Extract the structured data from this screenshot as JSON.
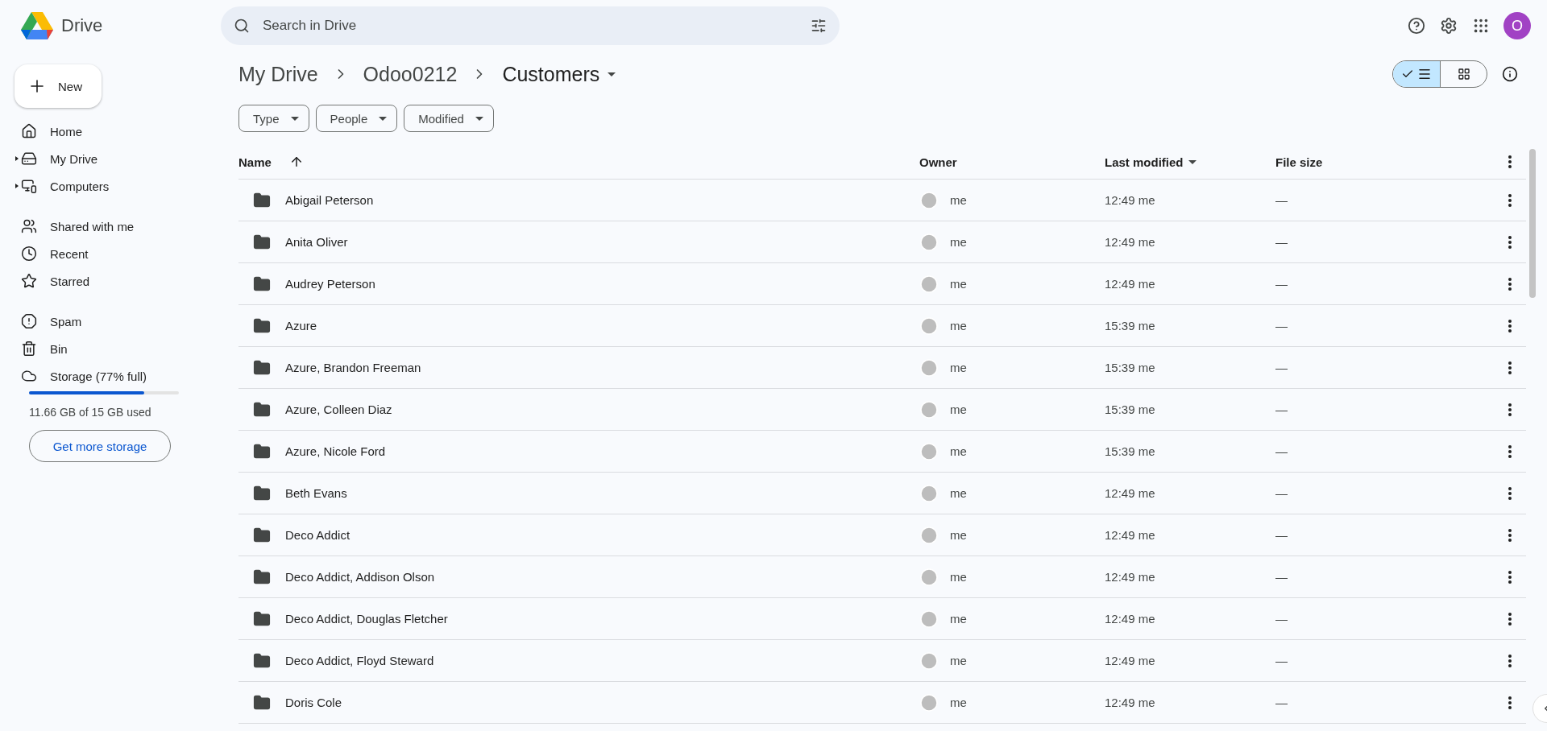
{
  "app": {
    "name": "Drive"
  },
  "search": {
    "placeholder": "Search in Drive"
  },
  "account": {
    "initial": "O"
  },
  "new_button": {
    "label": "New"
  },
  "sidebar": {
    "groups": [
      [
        {
          "kind": "home",
          "label": "Home",
          "expandable": false
        },
        {
          "kind": "drive",
          "label": "My Drive",
          "expandable": true
        },
        {
          "kind": "computers",
          "label": "Computers",
          "expandable": true
        }
      ],
      [
        {
          "kind": "shared",
          "label": "Shared with me",
          "expandable": false
        },
        {
          "kind": "recent",
          "label": "Recent",
          "expandable": false
        },
        {
          "kind": "starred",
          "label": "Starred",
          "expandable": false
        }
      ],
      [
        {
          "kind": "spam",
          "label": "Spam",
          "expandable": false
        },
        {
          "kind": "bin",
          "label": "Bin",
          "expandable": false
        },
        {
          "kind": "storage",
          "label": "Storage (77% full)",
          "expandable": false
        }
      ]
    ]
  },
  "storage": {
    "level": 0.77,
    "usage": "11.66 GB of 15 GB used",
    "button": "Get more storage"
  },
  "breadcrumb": [
    {
      "label": "My Drive"
    },
    {
      "label": "Odoo0212"
    },
    {
      "label": "Customers"
    }
  ],
  "view_toggle": [
    {
      "kind": "list",
      "selected": true
    },
    {
      "kind": "grid",
      "selected": false
    }
  ],
  "filters": [
    "Type",
    "People",
    "Modified"
  ],
  "table": {
    "columns": [
      {
        "label": "Name",
        "sorted": true,
        "menu": false
      },
      {
        "label": "Owner",
        "sorted": false,
        "menu": false
      },
      {
        "label": "Last modified",
        "sorted": false,
        "menu": true
      },
      {
        "label": "File size",
        "sorted": false,
        "menu": false
      }
    ],
    "rows": [
      {
        "name": "Abigail Peterson",
        "owner": "me",
        "modified": "12:49",
        "modified_by": "me",
        "size": "—"
      },
      {
        "name": "Anita Oliver",
        "owner": "me",
        "modified": "12:49",
        "modified_by": "me",
        "size": "—"
      },
      {
        "name": "Audrey Peterson",
        "owner": "me",
        "modified": "12:49",
        "modified_by": "me",
        "size": "—"
      },
      {
        "name": "Azure",
        "owner": "me",
        "modified": "15:39",
        "modified_by": "me",
        "size": "—"
      },
      {
        "name": "Azure, Brandon Freeman",
        "owner": "me",
        "modified": "15:39",
        "modified_by": "me",
        "size": "—"
      },
      {
        "name": "Azure, Colleen Diaz",
        "owner": "me",
        "modified": "15:39",
        "modified_by": "me",
        "size": "—"
      },
      {
        "name": "Azure, Nicole Ford",
        "owner": "me",
        "modified": "15:39",
        "modified_by": "me",
        "size": "—"
      },
      {
        "name": "Beth Evans",
        "owner": "me",
        "modified": "12:49",
        "modified_by": "me",
        "size": "—"
      },
      {
        "name": "Deco Addict",
        "owner": "me",
        "modified": "12:49",
        "modified_by": "me",
        "size": "—"
      },
      {
        "name": "Deco Addict, Addison Olson",
        "owner": "me",
        "modified": "12:49",
        "modified_by": "me",
        "size": "—"
      },
      {
        "name": "Deco Addict, Douglas Fletcher",
        "owner": "me",
        "modified": "12:49",
        "modified_by": "me",
        "size": "—"
      },
      {
        "name": "Deco Addict, Floyd Steward",
        "owner": "me",
        "modified": "12:49",
        "modified_by": "me",
        "size": "—"
      },
      {
        "name": "Doris Cole",
        "owner": "me",
        "modified": "12:49",
        "modified_by": "me",
        "size": "—"
      }
    ]
  }
}
